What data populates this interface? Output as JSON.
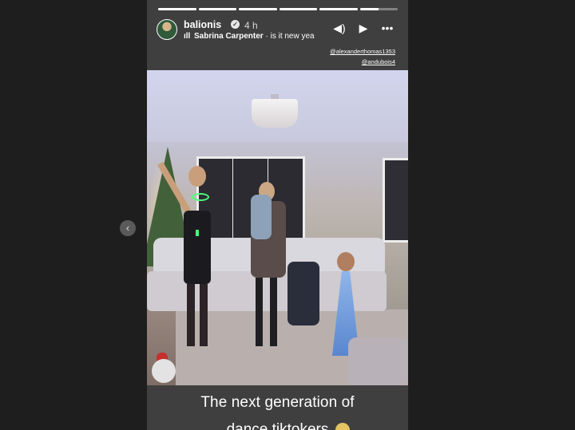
{
  "progress": {
    "segments": [
      1,
      1,
      1,
      1,
      1,
      0.5
    ],
    "active_index": 5
  },
  "header": {
    "username": "balionis",
    "verified": true,
    "time": "4 h",
    "music_artist": "Sabrina Carpenter",
    "music_track": "is it new yea"
  },
  "controls": {
    "volume_icon": "speaker-icon",
    "play_icon": "play-icon",
    "more_icon": "more-icon"
  },
  "mentions": [
    "@alexanderthomas1353",
    "@andubois4"
  ],
  "caption": {
    "line1": "The next generation of",
    "line2": "dance tiktokers"
  },
  "nav": {
    "prev_icon": "chevron-left-icon"
  },
  "colors": {
    "page_bg": "#1e1e1e",
    "story_bg": "#3f3f3f",
    "glow_stick": "#4dff7a"
  }
}
